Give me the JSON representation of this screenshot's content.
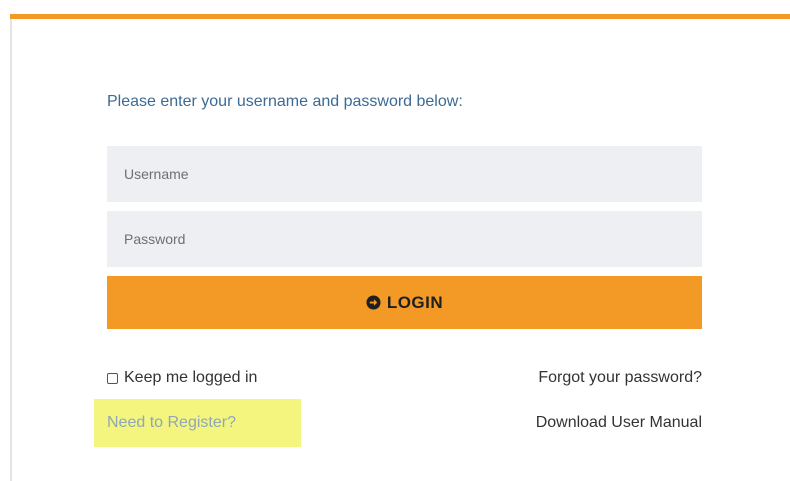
{
  "colors": {
    "accent": "#f39a26",
    "instruction_text": "#3b6a93",
    "input_background": "#eeeff3",
    "highlight": "#f4f57f",
    "register_link": "#8fa7b6"
  },
  "form": {
    "instruction": "Please enter your username and password below:",
    "username_placeholder": "Username",
    "username_value": "",
    "password_placeholder": "Password",
    "password_value": "",
    "login_label": "LOGIN",
    "login_icon": "arrow-circle-right-icon"
  },
  "options": {
    "keep_logged_in_label": "Keep me logged in",
    "keep_logged_in_checked": false,
    "forgot_password_label": "Forgot your password?",
    "register_label": "Need to Register?",
    "download_manual_label": "Download User Manual"
  }
}
